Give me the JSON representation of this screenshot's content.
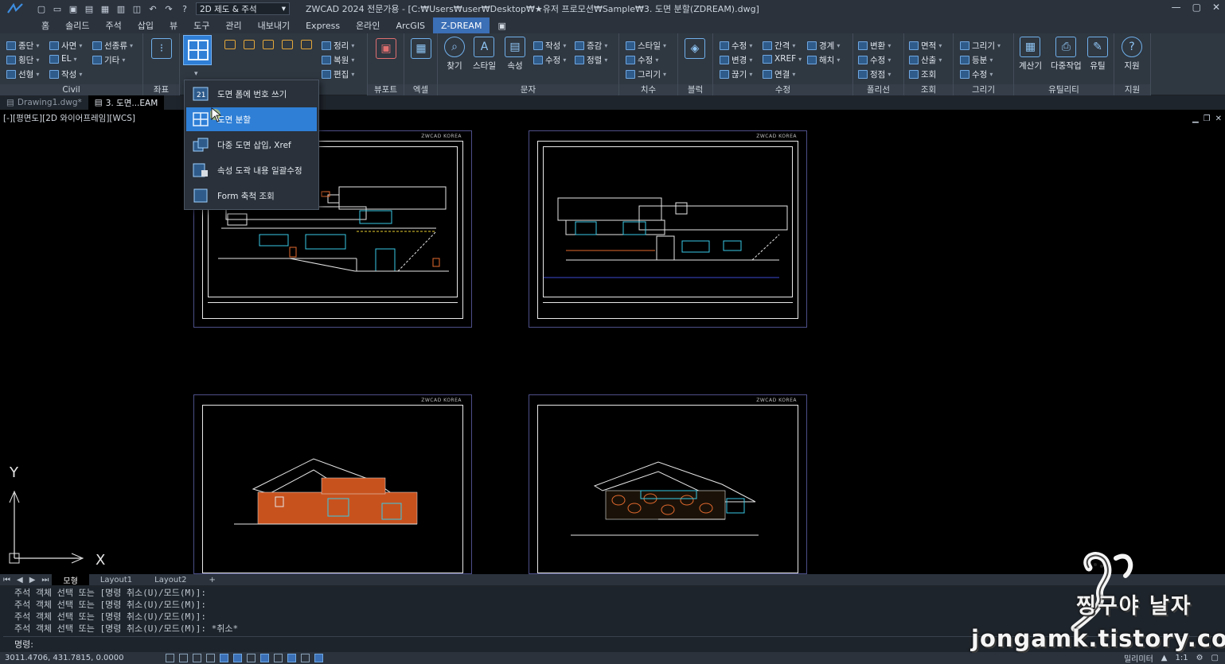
{
  "title_bar": {
    "workspace": "2D 제도 & 주석",
    "window_title": "ZWCAD 2024 전문가용 - [C:₩Users₩user₩Desktop₩★유저 프로모션₩Sample₩3. 도면 분할(ZDREAM).dwg]"
  },
  "ribbon_tabs": [
    "홈",
    "솔리드",
    "주석",
    "삽입",
    "뷰",
    "도구",
    "관리",
    "내보내기",
    "Express",
    "온라인",
    "ArcGIS",
    "Z-DREAM"
  ],
  "active_tab": "Z-DREAM",
  "panels": {
    "civil": {
      "label": "Civil",
      "items": [
        "종단",
        "사면",
        "선종류",
        "횡단",
        "EL",
        "기타",
        "선형",
        "작성"
      ]
    },
    "coord": {
      "label": "좌표"
    },
    "layout": {
      "items": [
        "정리",
        "복원",
        "편집"
      ]
    },
    "viewport": {
      "label": "뷰포트"
    },
    "excel": {
      "label": "엑셀"
    },
    "text": {
      "label": "문자",
      "big": [
        "찾기",
        "스타일",
        "속성"
      ],
      "items": [
        "작성",
        "증감",
        "수정",
        "정렬"
      ]
    },
    "dim": {
      "label": "치수",
      "items": [
        "스타일",
        "수정",
        "그리기"
      ]
    },
    "block": {
      "label": "블럭"
    },
    "modify": {
      "label": "수정",
      "items": [
        "수정",
        "간격",
        "경계",
        "변경",
        "XREF",
        "해치",
        "끊기",
        "연결"
      ]
    },
    "polyline": {
      "label": "폴리선",
      "items": [
        "변환",
        "수정",
        "정점"
      ]
    },
    "query": {
      "label": "조회",
      "items": [
        "면적",
        "산출",
        "조회"
      ]
    },
    "draw": {
      "label": "그리기",
      "items": [
        "그리기",
        "등분",
        "수정"
      ]
    },
    "utility": {
      "label": "유틸리티",
      "big": [
        "계산기",
        "다중작업",
        "유틸"
      ]
    },
    "support": {
      "label": "지원",
      "big": [
        "지원"
      ]
    }
  },
  "file_tabs": [
    "Drawing1.dwg*",
    "3. 도면...EAM"
  ],
  "viewport_label": "[-][평면도][2D 와이어프레임][WCS]",
  "sheet_brand": "ZWCAD KOREA",
  "dropdown": {
    "items": [
      "도면 폼에 번호 쓰기",
      "도면 분할",
      "다중 도면 삽입, Xref",
      "속성 도곽 내용 일괄수정",
      "Form 축척 조회"
    ],
    "active_index": 1
  },
  "layout_tabs": [
    "모형",
    "Layout1",
    "Layout2"
  ],
  "active_layout": "모형",
  "command_history": [
    "주석 객체 선택 또는 [명령 취소(U)/모드(M)]:",
    "주석 객체 선택 또는 [명령 취소(U)/모드(M)]:",
    "주석 객체 선택 또는 [명령 취소(U)/모드(M)]:",
    "주석 객체 선택 또는 [명령 취소(U)/모드(M)]: *취소*"
  ],
  "command_prompt": "명령:",
  "status": {
    "coordinates": "3011.4706, 431.7815, 0.0000",
    "units": "밀리미터",
    "scale": "1:1"
  },
  "watermark": {
    "name": "찡구야 날자",
    "url": "jongamk.tistory.com"
  },
  "colors": {
    "accent": "#2f7fd6",
    "ribbon_bg": "#2f3741",
    "drawing_bg": "#000000"
  }
}
